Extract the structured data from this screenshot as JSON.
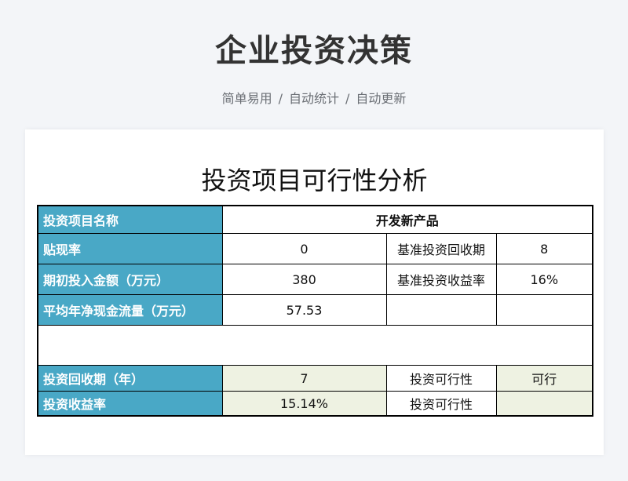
{
  "header": {
    "title": "企业投资决策",
    "subtitle_parts": [
      "简单易用",
      "自动统计",
      "自动更新"
    ],
    "separator": "/"
  },
  "sheet": {
    "title": "投资项目可行性分析",
    "rows": {
      "project_name": {
        "label": "投资项目名称",
        "value": "开发新产品"
      },
      "discount_rate": {
        "label": "贴现率",
        "value": "0",
        "side_label": "基准投资回收期",
        "side_value": "8"
      },
      "initial_investment": {
        "label": "期初投入金额（万元）",
        "value": "380",
        "side_label": "基准投资收益率",
        "side_value": "16%"
      },
      "avg_net_cashflow": {
        "label": "平均年净现金流量（万元）",
        "value": "57.53",
        "side_label": "",
        "side_value": ""
      },
      "payback_period": {
        "label": "投资回收期（年）",
        "value": "7",
        "side_label": "投资可行性",
        "side_value": "可行"
      },
      "return_rate": {
        "label": "投资收益率",
        "value": "15.14%",
        "side_label": "投资可行性",
        "side_value": ""
      }
    }
  },
  "colors": {
    "header_fill": "#49a8c6",
    "calc_fill": "#eef2e2",
    "background": "#f3f5f8"
  }
}
